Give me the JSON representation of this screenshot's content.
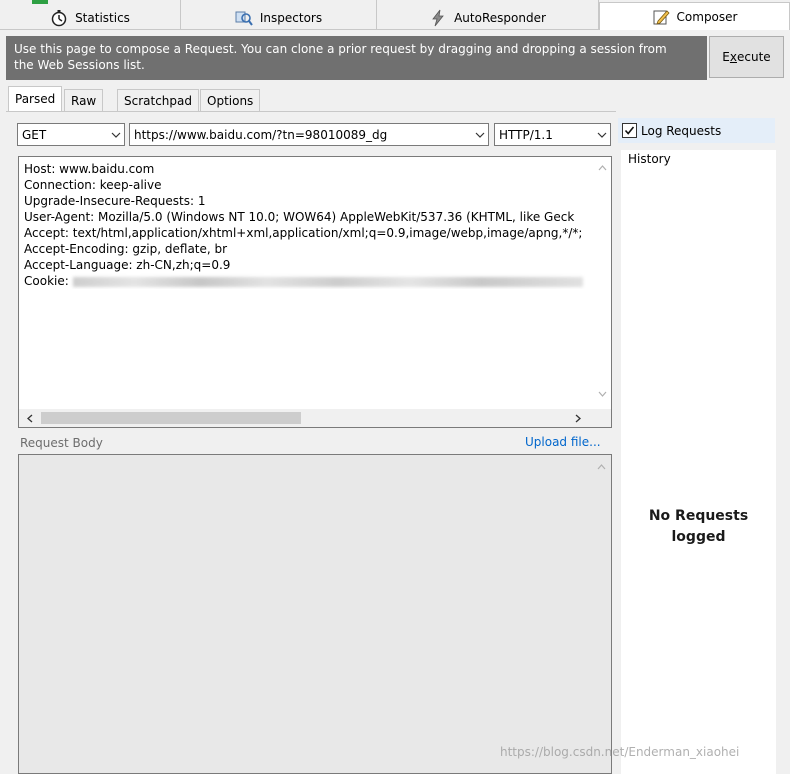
{
  "top_tabs": [
    {
      "label": "Statistics",
      "icon": "stopwatch-icon",
      "active": false
    },
    {
      "label": "Inspectors",
      "icon": "inspect-icon",
      "active": false
    },
    {
      "label": "AutoResponder",
      "icon": "lightning-icon",
      "active": false
    },
    {
      "label": "Composer",
      "icon": "pencil-icon",
      "active": true
    }
  ],
  "banner": {
    "line1": "Use this page to compose a Request. You can clone a prior request by dragging and dropping a session from",
    "line2": "the Web Sessions list."
  },
  "execute_button": {
    "pre": "E",
    "accel": "x",
    "post": "ecute"
  },
  "sub_tabs": [
    {
      "label": "Parsed",
      "active": true
    },
    {
      "label": "Raw",
      "active": false
    },
    {
      "label": "Scratchpad",
      "active": false
    },
    {
      "label": "Options",
      "active": false
    }
  ],
  "request": {
    "method": "GET",
    "url": "https://www.baidu.com/?tn=98010089_dg",
    "version": "HTTP/1.1"
  },
  "headers": [
    "Host: www.baidu.com",
    "Connection: keep-alive",
    "Upgrade-Insecure-Requests: 1",
    "User-Agent: Mozilla/5.0 (Windows NT 10.0; WOW64) AppleWebKit/537.36 (KHTML, like Geck",
    "Accept: text/html,application/xhtml+xml,application/xml;q=0.9,image/webp,image/apng,*/*;",
    "Accept-Encoding: gzip, deflate, br",
    "Accept-Language: zh-CN,zh;q=0.9"
  ],
  "cookie": {
    "label": "Cookie: ",
    "value": ""
  },
  "request_body": {
    "label": "Request Body",
    "upload_link": "Upload file..."
  },
  "right_panel": {
    "log_requests_label": "Log Requests",
    "log_requests_checked": true,
    "history_label": "History",
    "empty_line1": "No Requests",
    "empty_line2": "logged"
  },
  "watermark": "https://blog.csdn.net/Enderman_xiaohei"
}
